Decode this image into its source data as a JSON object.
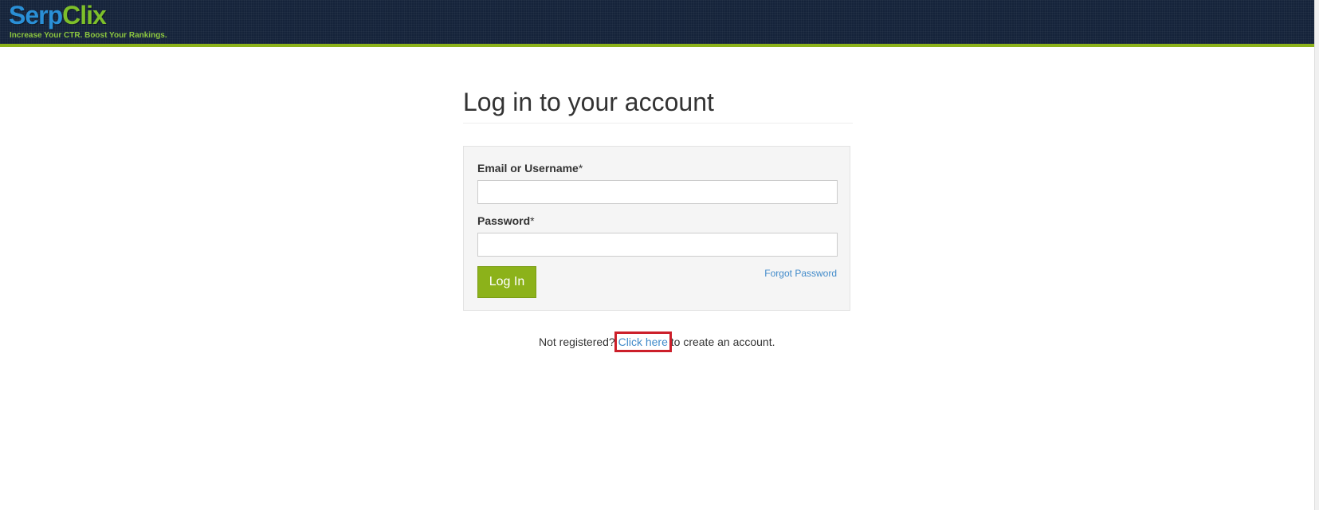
{
  "header": {
    "logo_part1": "Serp",
    "logo_part2": "Clix",
    "tagline": "Increase Your CTR. Boost Your Rankings."
  },
  "page": {
    "title": "Log in to your account"
  },
  "form": {
    "email_label": "Email or Username",
    "password_label": "Password",
    "required_mark": "*",
    "email_value": "",
    "password_value": "",
    "login_button": "Log In",
    "forgot_password": "Forgot Password"
  },
  "register": {
    "prefix": "Not registered? ",
    "link": "Click here",
    "suffix": " to create an account."
  },
  "colors": {
    "header_bg": "#15233a",
    "accent_green": "#8cb21a",
    "link_blue": "#428bca",
    "highlight_red": "#cc1f2a"
  }
}
